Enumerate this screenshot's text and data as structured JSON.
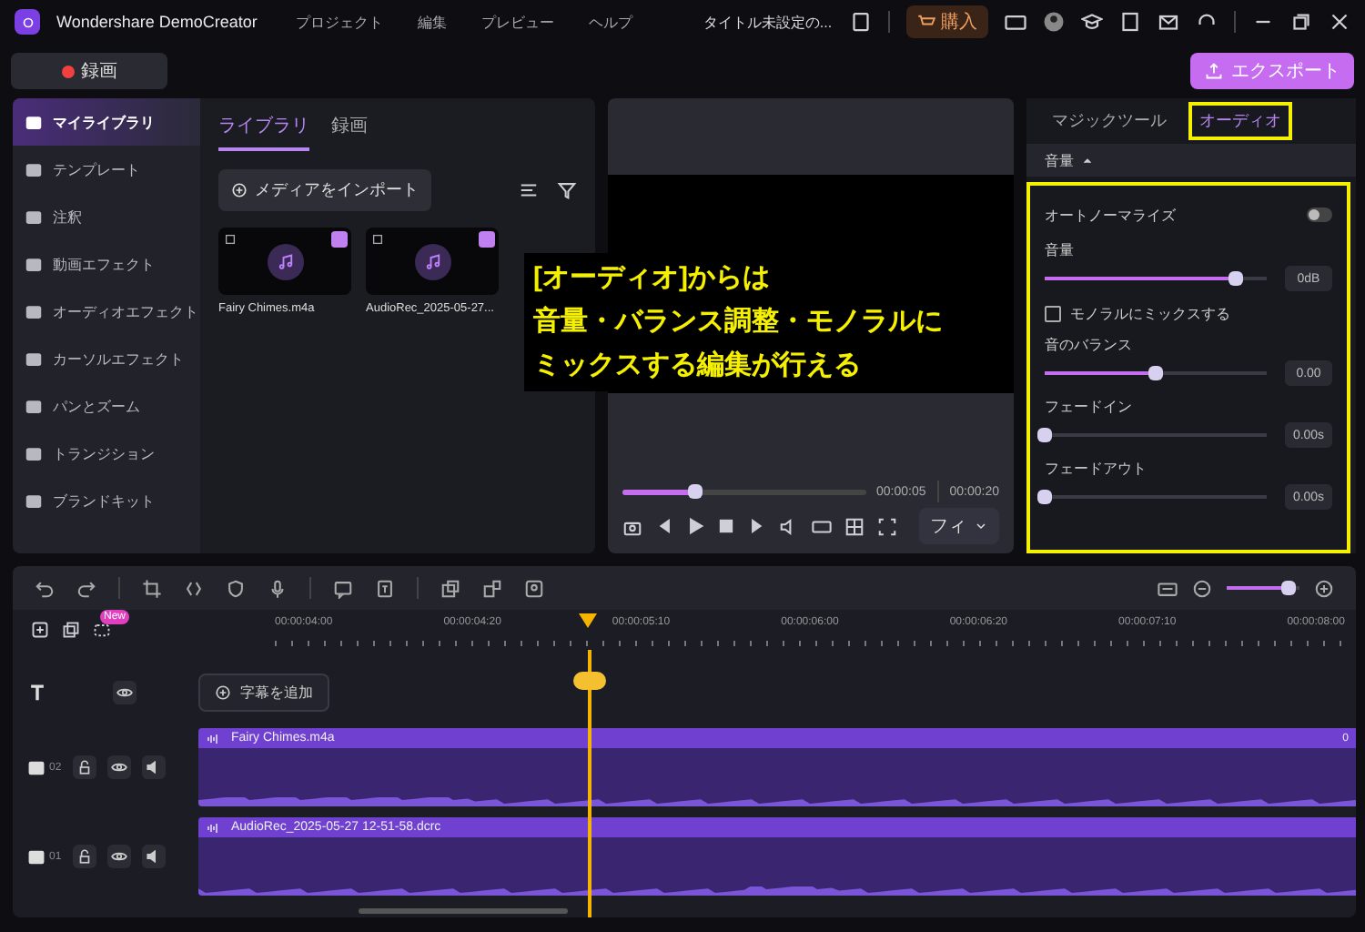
{
  "title_bar": {
    "app_name": "Wondershare DemoCreator",
    "menu": [
      "プロジェクト",
      "編集",
      "プレビュー",
      "ヘルプ"
    ],
    "document_title": "タイトル未設定の...",
    "buy_button": "購入"
  },
  "top_bar": {
    "record_button": "録画",
    "export_button": "エクスポート"
  },
  "sidebar": {
    "items": [
      {
        "label": "マイライブラリ",
        "selected": true
      },
      {
        "label": "テンプレート",
        "selected": false
      },
      {
        "label": "注釈",
        "selected": false
      },
      {
        "label": "動画エフェクト",
        "selected": false
      },
      {
        "label": "オーディオエフェクト",
        "selected": false
      },
      {
        "label": "カーソルエフェクト",
        "selected": false
      },
      {
        "label": "パンとズーム",
        "selected": false
      },
      {
        "label": "トランジション",
        "selected": false
      },
      {
        "label": "ブランドキット",
        "selected": false
      }
    ]
  },
  "library": {
    "tabs": [
      {
        "label": "ライブラリ",
        "selected": true
      },
      {
        "label": "録画",
        "selected": false
      }
    ],
    "import_button": "メディアをインポート",
    "media": [
      {
        "name": "Fairy Chimes.m4a"
      },
      {
        "name": "AudioRec_2025-05-27..."
      }
    ]
  },
  "preview": {
    "level": 0.3,
    "current_time": "00:00:05",
    "total_time": "00:00:20",
    "fit_dropdown": "フィ"
  },
  "annotation": {
    "lines": [
      "[オーディオ]からは",
      "音量・バランス調整・モノラルに",
      "ミックスする編集が行える"
    ]
  },
  "properties": {
    "tabs": [
      {
        "label": "マジックツール",
        "selected": false
      },
      {
        "label": "オーディオ",
        "selected": true
      }
    ],
    "section": "音量",
    "settings": [
      {
        "kind": "toggle",
        "label": "オートノーマライズ",
        "on": false
      },
      {
        "kind": "slider",
        "label": "音量",
        "level": 0.86,
        "value": "0dB"
      },
      {
        "kind": "checkbox",
        "label": "モノラルにミックスする",
        "checked": false
      },
      {
        "kind": "slider",
        "label": "音のバランス",
        "level": 0.5,
        "value": "0.00"
      },
      {
        "kind": "slider",
        "label": "フェードイン",
        "level": 0,
        "value": "0.00s"
      },
      {
        "kind": "slider",
        "label": "フェードアウト",
        "level": 0,
        "value": "0.00s"
      }
    ]
  },
  "timeline": {
    "zoom": {
      "level": 0.85
    },
    "new_badge": "New",
    "ruler": [
      "00:00:04:00",
      "00:00:04:20",
      "00:00:05:10",
      "00:00:06:00",
      "00:00:06:20",
      "00:00:07:10",
      "00:00:08:00"
    ],
    "add_subtitle_button": "字幕を追加",
    "tracks": [
      {
        "number": "02",
        "clip": "Fairy Chimes.m4a",
        "end_mark": "0"
      },
      {
        "number": "01",
        "clip": "AudioRec_2025-05-27 12-51-58.dcrc"
      }
    ]
  }
}
